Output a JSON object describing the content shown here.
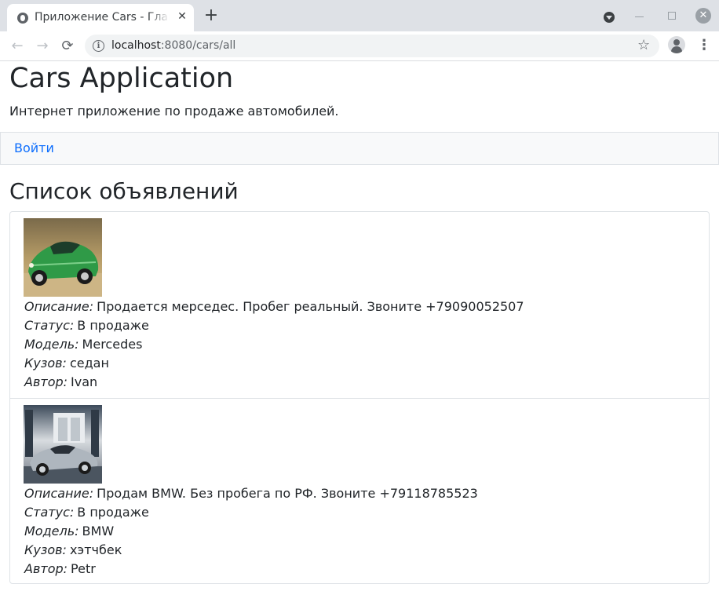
{
  "browser": {
    "tab_title": "Приложение Cars - Главная",
    "url_host": "localhost",
    "url_rest": ":8080/cars/all"
  },
  "page": {
    "title": "Cars Application",
    "subtitle": "Интернет приложение по продаже автомобилей.",
    "nav_login": "Войти",
    "list_title": "Список объявлений"
  },
  "labels": {
    "description": "Описание:",
    "status": "Статус:",
    "model": "Модель:",
    "body": "Кузов:",
    "author": "Автор:"
  },
  "ads": [
    {
      "description": "Продается мерседес. Пробег реальный. Звоните +79090052507",
      "status": "В продаже",
      "model": "Mercedes",
      "body": "седан",
      "author": "Ivan"
    },
    {
      "description": "Продам BMW. Без пробега по РФ. Звоните +79118785523",
      "status": "В продаже",
      "model": "BMW",
      "body": "хэтчбек",
      "author": "Petr"
    }
  ]
}
